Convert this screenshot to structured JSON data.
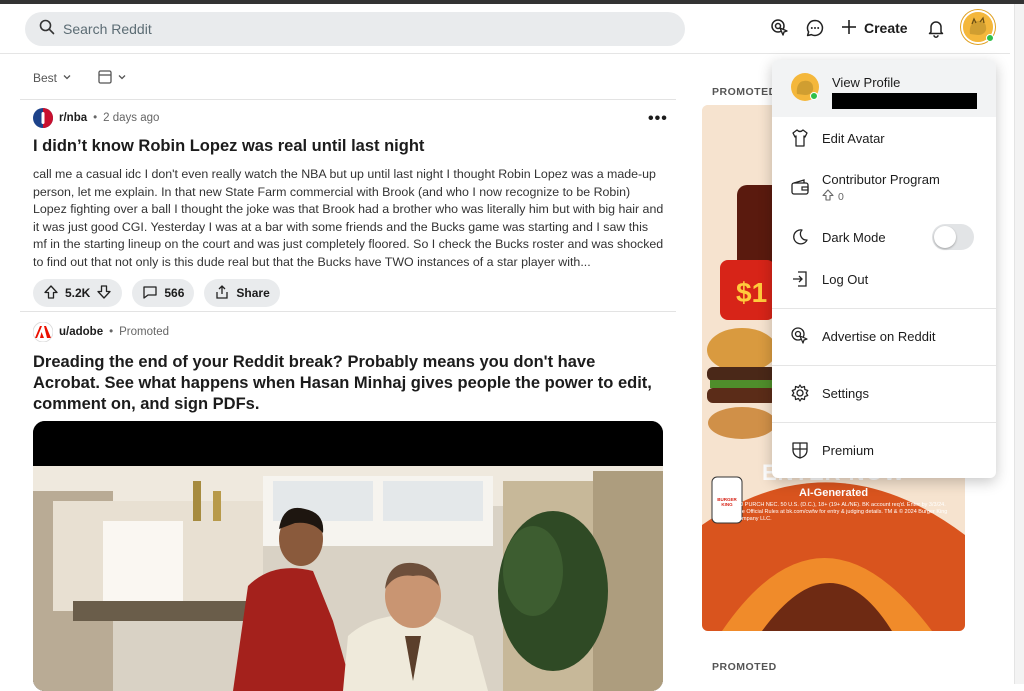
{
  "header": {
    "search_placeholder": "Search Reddit",
    "create_label": "Create",
    "icons": [
      "advertise-icon",
      "chat-icon",
      "plus-icon",
      "bell-icon",
      "avatar"
    ]
  },
  "feed": {
    "sort_label": "Best",
    "view_icon": "card-view-icon"
  },
  "posts": [
    {
      "subreddit": "r/nba",
      "time": "2 days ago",
      "title": "I didn’t know Robin Lopez was real until last night",
      "body": "call me a casual idc I don't even really watch the NBA but up until last night I thought Robin Lopez was a made-up person, let me explain. In that new State Farm commercial with Brook (and who I now recognize to be Robin) Lopez fighting over a ball I thought the joke was that Brook had a brother who was literally him but with big hair and it was just good CGI. Yesterday I was at a bar with some friends and the Bucks game was starting and I saw this mf in the starting lineup on the court and was just completely floored. So I check the Bucks roster and was shocked to find out that not only is this dude real but that the Bucks have TWO instances of a star player with...",
      "votes": "5.2K",
      "comments": "566",
      "share_label": "Share"
    },
    {
      "subreddit": "u/adobe",
      "tag": "Promoted",
      "title": "Dreading the end of your Reddit break? Probably means you don't have Acrobat. See what happens when Hasan Minhaj gives people the power to edit, comment on, and sign PDFs."
    }
  ],
  "sidebar": {
    "promoted_label": "PROMOTED",
    "ad_text": {
      "headline": "ENTER NOW",
      "subline": "AI-Generated",
      "fine_print": "NO PURCH NEC. 50 U.S. (D.C.), 18+ (19+ AL/NE). BK account req'd. Enter by 3/3/24. See Official Rules at bk.com/cwfw for entry & judging details. TM & © 2024 Burger King Company LLC.",
      "brand": "BURGER KING"
    }
  },
  "menu": {
    "items": [
      {
        "label": "View Profile",
        "icon": "avatar"
      },
      {
        "label": "Edit Avatar",
        "icon": "shirt-icon"
      },
      {
        "label": "Contributor Program",
        "sub": "0",
        "icon": "wallet-icon"
      },
      {
        "label": "Dark Mode",
        "icon": "moon-icon",
        "toggle": false
      },
      {
        "label": "Log Out",
        "icon": "logout-icon"
      },
      {
        "label": "Advertise on Reddit",
        "icon": "advertise-icon"
      },
      {
        "label": "Settings",
        "icon": "gear-icon"
      },
      {
        "label": "Premium",
        "icon": "premium-shield-icon"
      }
    ]
  },
  "colors": {
    "search_bg": "#e9ebed",
    "pill_bg": "#e9ebed",
    "avatar_bg": "#f4b73b",
    "online": "#2fbf4a",
    "nba_blue": "#1d428a",
    "nba_red": "#c8102e",
    "adobe_red": "#eb1000"
  }
}
